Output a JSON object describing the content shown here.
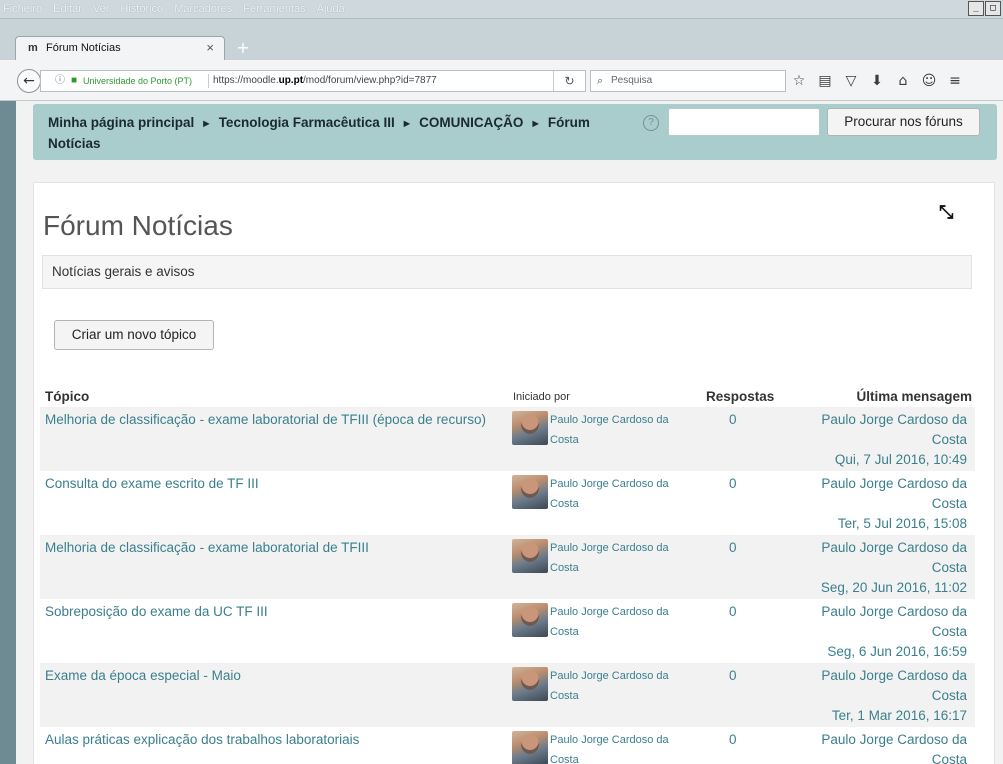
{
  "browser": {
    "menus": [
      "Ficheiro",
      "Editar",
      "Ver",
      "Histórico",
      "Marcadores",
      "Ferramentas",
      "Ajuda"
    ],
    "tab_title": "Fórum Notícias",
    "site_identity": "Universidade do Porto (PT)",
    "url_prefix": "https://moodle.",
    "url_domain": "up.pt",
    "url_path": "/mod/forum/view.php?id=7877",
    "search_placeholder": "Pesquisa"
  },
  "breadcrumb": {
    "item1": "Minha página principal",
    "item2": "Tecnologia Farmacêutica III",
    "item3": "COMUNICAÇÃO",
    "item4": "Fórum Notícias",
    "separator": "►"
  },
  "search": {
    "button_label": "Procurar nos fóruns"
  },
  "forum": {
    "title": "Fórum Notícias",
    "intro": "Notícias gerais e avisos",
    "new_topic_label": "Criar um novo tópico",
    "columns": {
      "topic": "Tópico",
      "started_by": "Iniciado por",
      "replies": "Respostas",
      "last_post": "Última mensagem"
    },
    "rows": [
      {
        "topic": "Melhoria de classificação - exame laboratorial de TFIII (época de recurso)",
        "author": "Paulo Jorge Cardoso da Costa",
        "replies": "0",
        "last_author_line1": "Paulo Jorge Cardoso da",
        "last_author_line2": "Costa",
        "last_date": "Qui, 7 Jul 2016, 10:49"
      },
      {
        "topic": "Consulta do exame escrito de TF III",
        "author": "Paulo Jorge Cardoso da Costa",
        "replies": "0",
        "last_author_line1": "Paulo Jorge Cardoso da",
        "last_author_line2": "Costa",
        "last_date": "Ter, 5 Jul 2016, 15:08"
      },
      {
        "topic": "Melhoria de classificação - exame laboratorial de TFIII",
        "author": "Paulo Jorge Cardoso da Costa",
        "replies": "0",
        "last_author_line1": "Paulo Jorge Cardoso da",
        "last_author_line2": "Costa",
        "last_date": "Seg, 20 Jun 2016, 11:02"
      },
      {
        "topic": "Sobreposição do exame da UC TF III",
        "author": "Paulo Jorge Cardoso da Costa",
        "replies": "0",
        "last_author_line1": "Paulo Jorge Cardoso da",
        "last_author_line2": "Costa",
        "last_date": "Seg, 6 Jun 2016, 16:59"
      },
      {
        "topic": "Exame da época especial - Maio",
        "author": "Paulo Jorge Cardoso da Costa",
        "replies": "0",
        "last_author_line1": "Paulo Jorge Cardoso da",
        "last_author_line2": "Costa",
        "last_date": "Ter, 1 Mar 2016, 16:17"
      },
      {
        "topic": "Aulas práticas explicação dos trabalhos laboratoriais",
        "author": "Paulo Jorge Cardoso da Costa",
        "replies": "0",
        "last_author_line1": "Paulo Jorge Cardoso da",
        "last_author_line2": "Costa",
        "last_date": ""
      }
    ]
  },
  "colors": {
    "link": "#3a7f8e",
    "navbar_bg": "#a9cccd",
    "page_bg": "#f2f2f2"
  }
}
